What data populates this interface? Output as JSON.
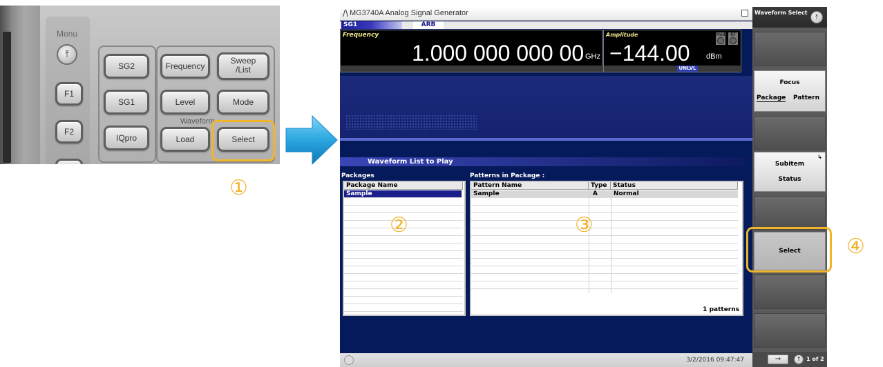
{
  "panel": {
    "menu_label": "Menu",
    "buttons": {
      "f1": "F1",
      "f2": "F2",
      "sg2": "SG2",
      "sg1": "SG1",
      "iqpro": "IQpro",
      "frequency": "Frequency",
      "sweep1": "Sweep",
      "sweep2": "/List",
      "level": "Level",
      "mode": "Mode",
      "load": "Load",
      "select": "Select"
    },
    "waveform_group_label": "Waveform"
  },
  "callouts": [
    "①",
    "②",
    "③",
    "④"
  ],
  "screen": {
    "title": "MG3740A  Analog Signal Generator",
    "tabs": {
      "sg1": "SG1",
      "arb": "ARB"
    },
    "frequency": {
      "label": "Frequency",
      "value": "1.000 000 000 00",
      "unit": "GHz"
    },
    "amplitude": {
      "label": "Amplitude",
      "value": "−144.00",
      "unit": "dBm",
      "status": "UNLVL",
      "mod_label": "Mod",
      "rf_label": "RF"
    },
    "list_header": "Waveform List to Play",
    "packages": {
      "label": "Packages",
      "column": "Package Name",
      "rows": [
        "Sample"
      ]
    },
    "patterns": {
      "label": "Patterns in Package :",
      "columns": [
        "Pattern Name",
        "Type",
        "Status"
      ],
      "rows": [
        {
          "name": "Sample",
          "type": "A",
          "status": "Normal"
        }
      ],
      "count": "1 patterns"
    },
    "datetime": "3/2/2016 09:47:47"
  },
  "sidebar": {
    "title": "Waveform Select",
    "focus": {
      "label": "Focus",
      "option1": "Package",
      "option2": "Pattern"
    },
    "subitem": {
      "label": "Subitem",
      "value": "Status"
    },
    "select": "Select",
    "page": "1 of 2"
  },
  "colors": {
    "highlight": "#f2b52a",
    "screen_bg": "#051a5a",
    "arrow": "#29a9e1"
  }
}
